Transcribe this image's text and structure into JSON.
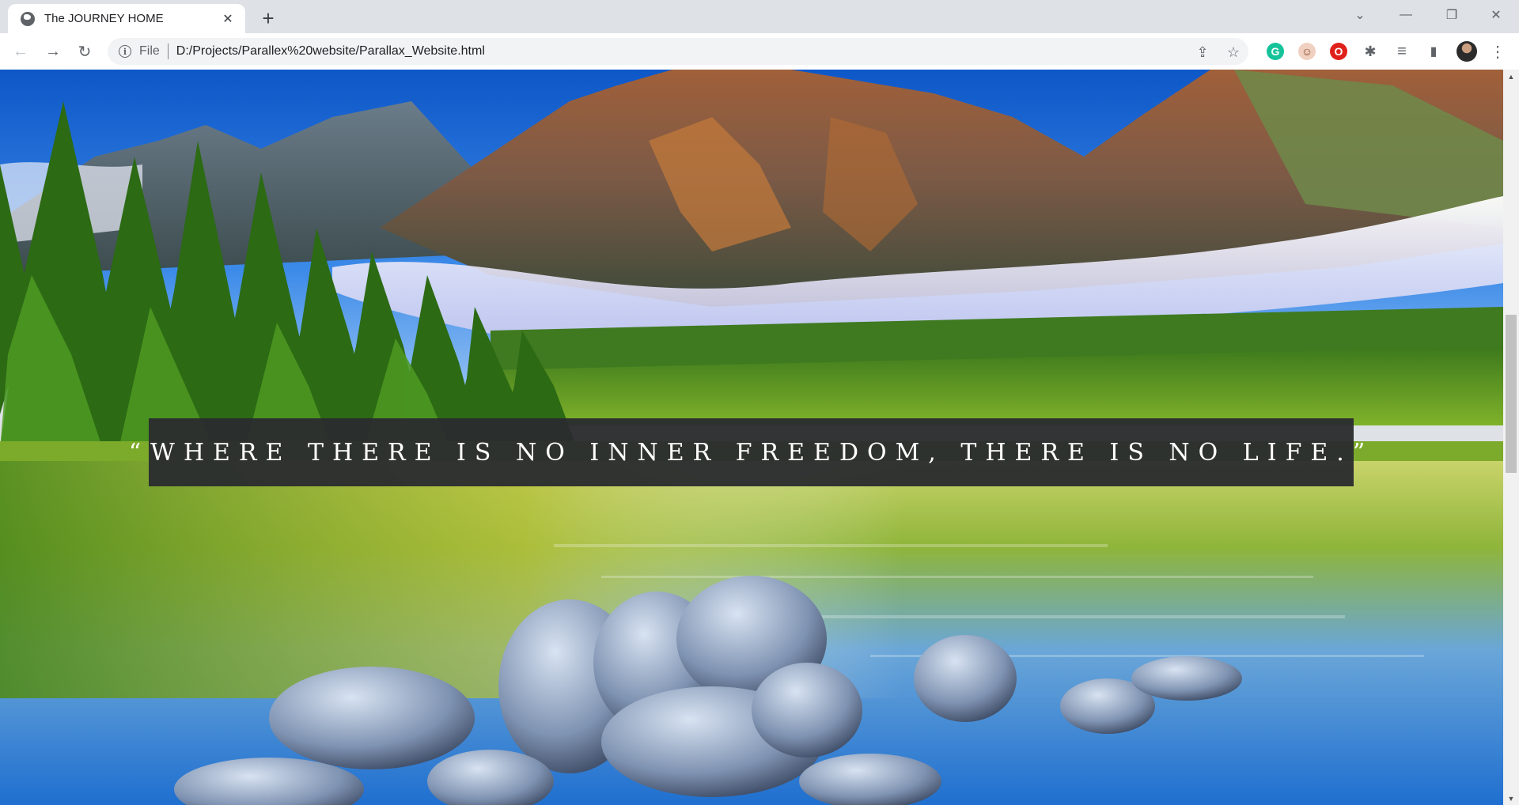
{
  "browser": {
    "tab_title": "The JOURNEY HOME",
    "tab_close_glyph": "✕",
    "new_tab_glyph": "+",
    "window_controls": {
      "dropdown": "⌄",
      "minimize": "—",
      "restore": "❐",
      "close": "✕"
    }
  },
  "toolbar": {
    "back_glyph": "←",
    "forward_glyph": "→",
    "reload_glyph": "↻",
    "info_glyph": "i",
    "scheme_label": "File",
    "url": "D:/Projects/Parallex%20website/Parallax_Website.html",
    "share_glyph": "⇪",
    "star_glyph": "☆",
    "menu_glyph": "⋮"
  },
  "extensions": [
    {
      "name": "grammarly-icon",
      "color": "#15c39a",
      "glyph": "G"
    },
    {
      "name": "avatar-extension-icon",
      "color": "#e0a080",
      "glyph": "☺"
    },
    {
      "name": "opera-adblock-icon",
      "color": "#e0211b",
      "glyph": "O"
    },
    {
      "name": "puzzle-extensions-icon",
      "color": "#5f6368",
      "glyph": "✱"
    },
    {
      "name": "media-queue-icon",
      "color": "#5f6368",
      "glyph": "≡"
    },
    {
      "name": "side-panel-icon",
      "color": "#5f6368",
      "glyph": "▮"
    }
  ],
  "page": {
    "quote": "“WHERE THERE IS NO INNER FREEDOM, THERE IS NO LIFE.”"
  },
  "colors": {
    "chrome_bg": "#dee1e6",
    "quote_box": "#2b2d2f",
    "quote_text": "#ffffff"
  }
}
